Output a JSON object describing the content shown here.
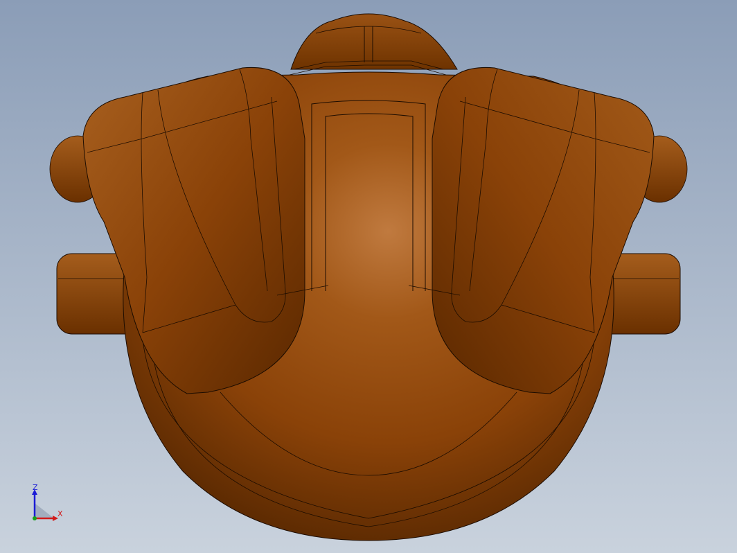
{
  "viewport": {
    "background_top": "#8b9db7",
    "background_bottom": "#c9d2dd",
    "model_color": "#8a4208",
    "model_highlight": "#c07a3f",
    "model_shadow": "#4e2300",
    "edge_color": "#1c0c00"
  },
  "triad": {
    "z_label": "Z",
    "x_label": "X",
    "z_color": "#1b1bd6",
    "x_color": "#d21b1b",
    "y_color": "#18a018"
  }
}
